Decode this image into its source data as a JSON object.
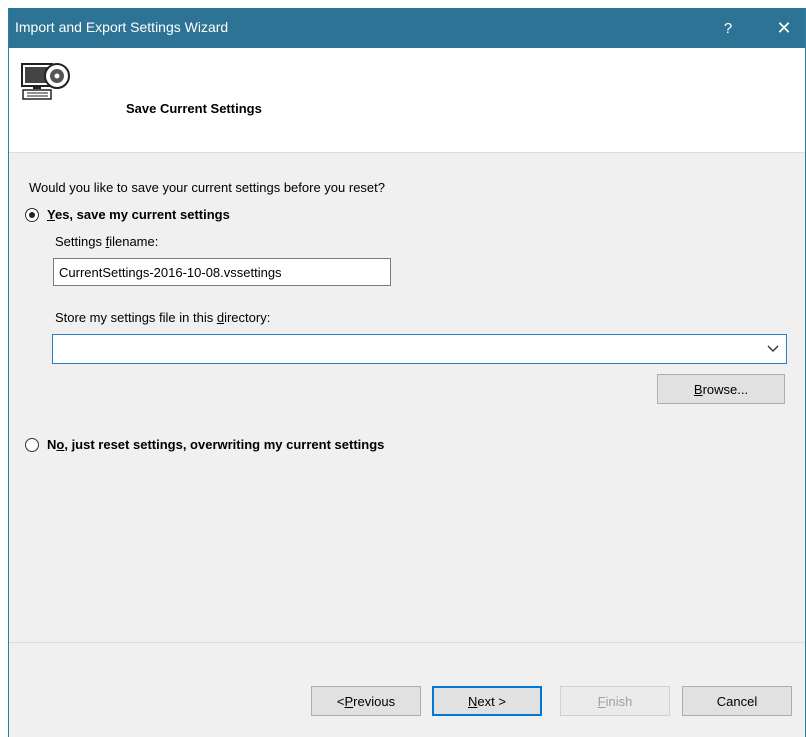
{
  "window": {
    "title": "Import and Export Settings Wizard",
    "help_glyph": "?",
    "close_glyph": "✕",
    "accent_color": "#2d7396"
  },
  "header": {
    "icon": "computer-disc-icon",
    "title": "Save Current Settings"
  },
  "body": {
    "question": "Would you like to save your current settings before you reset?",
    "option_yes": {
      "accel": "Y",
      "rest": "es, save my current settings",
      "selected": true
    },
    "filename_label": {
      "pre": "Settings ",
      "accel": "f",
      "post": "ilename:"
    },
    "filename_value": "CurrentSettings-2016-10-08.vssettings",
    "directory_label": {
      "pre": "Store my settings file in this ",
      "accel": "d",
      "post": "irectory:"
    },
    "directory_value": "",
    "browse_button": {
      "accel": "B",
      "rest": "rowse..."
    },
    "option_no": {
      "pre": "N",
      "accel": "o",
      "rest": ", just reset settings, overwriting my current settings",
      "selected": false
    }
  },
  "footer": {
    "previous": {
      "pre": "< ",
      "accel": "P",
      "rest": "revious"
    },
    "next": {
      "accel": "N",
      "rest": "ext >"
    },
    "finish": {
      "accel": "F",
      "rest": "inish"
    },
    "cancel": "Cancel"
  }
}
